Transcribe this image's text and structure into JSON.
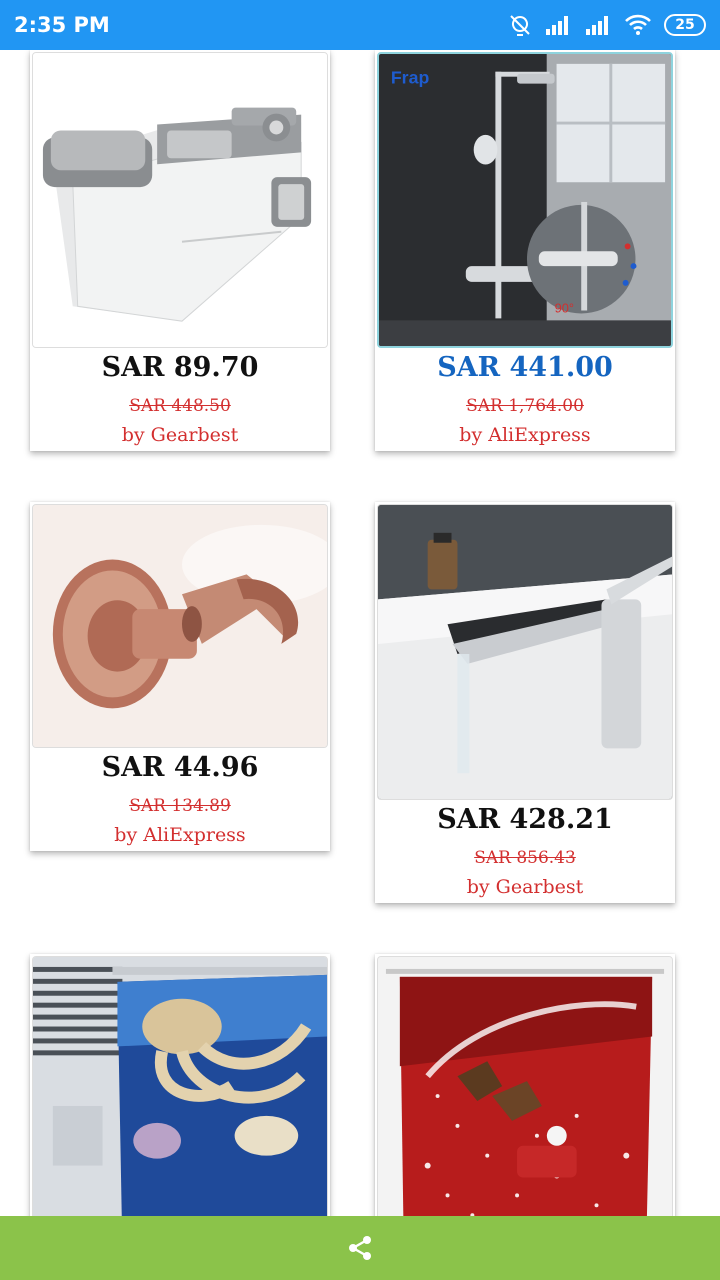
{
  "status_bar": {
    "time": "2:35 PM",
    "battery": "25"
  },
  "products": [
    {
      "price": "SAR 89.70",
      "old_price": "SAR 448.50",
      "seller": "by Gearbest",
      "image": "toothbrush-holder"
    },
    {
      "price": "SAR 441.00",
      "old_price": "SAR 1,764.00",
      "seller": "by AliExpress",
      "image": "shower-system",
      "brand_logo": "Frap"
    },
    {
      "price": "SAR 44.96",
      "old_price": "SAR 134.89",
      "seller": "by AliExpress",
      "image": "shower-head-holder"
    },
    {
      "price": "SAR 428.21",
      "old_price": "SAR 856.43",
      "seller": "by Gearbest",
      "image": "basin-faucet"
    },
    {
      "image": "octopus-shower-curtain"
    },
    {
      "image": "christmas-shower-curtain"
    }
  ],
  "colors": {
    "status_bar": "#2196f3",
    "bottom_bar": "#8bc34a",
    "price_highlight": "#1565c0",
    "old_price": "#d32f2f",
    "seller": "#d32f2f"
  },
  "bottom_bar": {
    "icon": "share-icon"
  }
}
